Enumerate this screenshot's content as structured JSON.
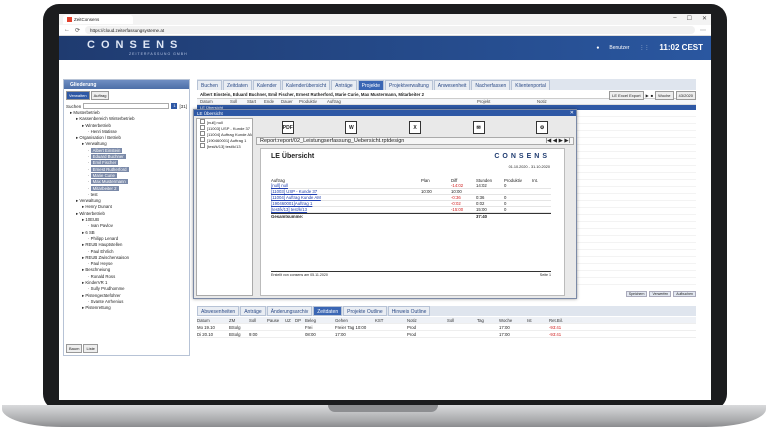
{
  "browser": {
    "tab_title": "ZeitConsens",
    "url": "https://cloud.zeiterfassungsysteme.at"
  },
  "header": {
    "logo": "CONSENS",
    "logo_sub": "ZEITERFASSUNG GMBH",
    "user_label": "Benutzer",
    "time": "11:02 CEST"
  },
  "left": {
    "title": "Gliederung",
    "tabs": [
      "Verwalten",
      "Auftrag"
    ],
    "search_label": "Suchen",
    "search_count": "[31]",
    "tree": [
      {
        "t": "Musterbetrieb",
        "d": 0
      },
      {
        "t": "Kassenbereich Winterbetrieb",
        "d": 1
      },
      {
        "t": "Winterbetrieb",
        "d": 2
      },
      {
        "t": "Henri Matisse",
        "d": 3
      },
      {
        "t": "Organisation / Betrieb",
        "d": 1
      },
      {
        "t": "Verwaltung",
        "d": 2
      },
      {
        "t": "Albert Einstein",
        "d": 3,
        "h": true
      },
      {
        "t": "Eduard Buchner",
        "d": 3,
        "h": true
      },
      {
        "t": "Emil Fischer",
        "d": 3,
        "h": true
      },
      {
        "t": "Ernest Rutherford",
        "d": 3,
        "h": true
      },
      {
        "t": "Marie Curie",
        "d": 3,
        "h": true
      },
      {
        "t": "Max Mustermann",
        "d": 3,
        "h": true
      },
      {
        "t": "Mitarbeiter 2",
        "d": 3,
        "h": true
      },
      {
        "t": "test",
        "d": 3
      },
      {
        "t": "Verwaltung",
        "d": 1
      },
      {
        "t": "Henry Dunant",
        "d": 2
      },
      {
        "t": "Winterbetrieb",
        "d": 1
      },
      {
        "t": "10EUB",
        "d": 2
      },
      {
        "t": "Ivan Pavlov",
        "d": 3
      },
      {
        "t": "6 SB",
        "d": 2
      },
      {
        "t": "Philipp Lenard",
        "d": 3
      },
      {
        "t": "REUB Hauptstellen",
        "d": 2
      },
      {
        "t": "Paul Ehrlich",
        "d": 3
      },
      {
        "t": "REUB Zwischensaison",
        "d": 2
      },
      {
        "t": "Paul Heyse",
        "d": 3
      },
      {
        "t": "Beschneiung",
        "d": 2
      },
      {
        "t": "Ronald Ross",
        "d": 3
      },
      {
        "t": "KinderVR 1",
        "d": 2
      },
      {
        "t": "Sully Prudhomme",
        "d": 3
      },
      {
        "t": "Pistengeräteführer",
        "d": 2
      },
      {
        "t": "Svante Arrhenius",
        "d": 3
      },
      {
        "t": "Pistenrettung",
        "d": 2
      }
    ],
    "footer_btns": [
      "Baum",
      "Liste"
    ]
  },
  "tabs": [
    "Buchen",
    "Zeitdaten",
    "Kalender",
    "Kalenderübersicht",
    "Anträge",
    "Projekte",
    "Projektverwaltung",
    "Anwesenheit",
    "Nacherfassen",
    "Klientenportal"
  ],
  "names": "Albert Einstein, Eduard Buchner, Emil Fischer, Ernest Rutherford, Marie Curie, Max Mustermann, Mitarbeiter 2",
  "namectl": {
    "export": "LE Excel Export",
    "week": "Woche",
    "date": "43/2020"
  },
  "columns": [
    "Datum",
    "Soll",
    "Start",
    "Ende",
    "Dauer",
    "Produktiv",
    "Auftrag",
    "Projekt",
    "Notiz"
  ],
  "selected_row": "LE Übersicht",
  "bottom_right_btns": [
    "Speichern",
    "Verwerfen",
    "Aufbuchen"
  ],
  "btabs": [
    "Abwesenheiten",
    "Anträge",
    "Änderungsarchiv",
    "Zeitdaten",
    "Projekte Outline",
    "Hinweis Outline"
  ],
  "btable": {
    "head": [
      "Datum",
      "ZM",
      "Soll",
      "Pause",
      "UZ",
      "DP",
      "Beleg",
      "Gehen",
      "KST",
      "Notiz",
      "Soll",
      "Tag",
      "Woche",
      "Ist",
      "Ret.Bil."
    ],
    "rows": [
      [
        "Mo 19.10",
        "BSolg",
        "",
        "",
        "",
        "",
        "Frei",
        "Freier Tag 10:00",
        "",
        "Prod",
        "",
        "",
        "17:00",
        "",
        "-93:41"
      ],
      [
        "Di 20.10",
        "BSolg",
        "9:00",
        "",
        "",
        "",
        "08:00",
        "17:00",
        "",
        "Prod",
        "",
        "",
        "17:00",
        "",
        "-93:41"
      ]
    ]
  },
  "modal": {
    "title": "LE Übersicht",
    "side": [
      "[null] null",
      "[11003] USP - Kunde 37",
      "[11004] Auftrag Kunde AM",
      "[190460001] Auftrag 1",
      "[test/k/13] test/k/13"
    ],
    "icons": [
      "PDF",
      "W",
      "X",
      "mail",
      "gear"
    ],
    "reportpath": "Report:report/02_Leistungserfassung_Uebersicht.rptdesign",
    "report": {
      "title": "LE Übersicht",
      "logo": "CONSENS",
      "date": "01.10.2020 - 31.10.2020",
      "head": [
        "Auftrag",
        "Plan",
        "Diff",
        "Stunden",
        "Produktiv",
        "Int."
      ],
      "rows": [
        [
          "[null] null",
          "",
          "-14:02",
          "14:02",
          "0"
        ],
        [
          "[11003] USP - Kunde 37",
          "10:00",
          "10:00",
          "",
          ""
        ],
        [
          "[11004] Auftrag Kunde AM",
          "",
          "-0:36",
          "0:36",
          "0"
        ],
        [
          "[190460001]Auftrag 1",
          "",
          "-0:02",
          "0:02",
          "0"
        ],
        [
          "[test/k/13] test/k/13",
          "",
          "-15:00",
          "15:00",
          "0"
        ]
      ],
      "total_label": "Gesamtsumme:",
      "total": "37:40",
      "footer": "Erstellt von consens am 05.11.2020",
      "page": "Seite 1"
    }
  },
  "colors": {
    "accent": "#2e58a5",
    "red": "#d02020"
  }
}
